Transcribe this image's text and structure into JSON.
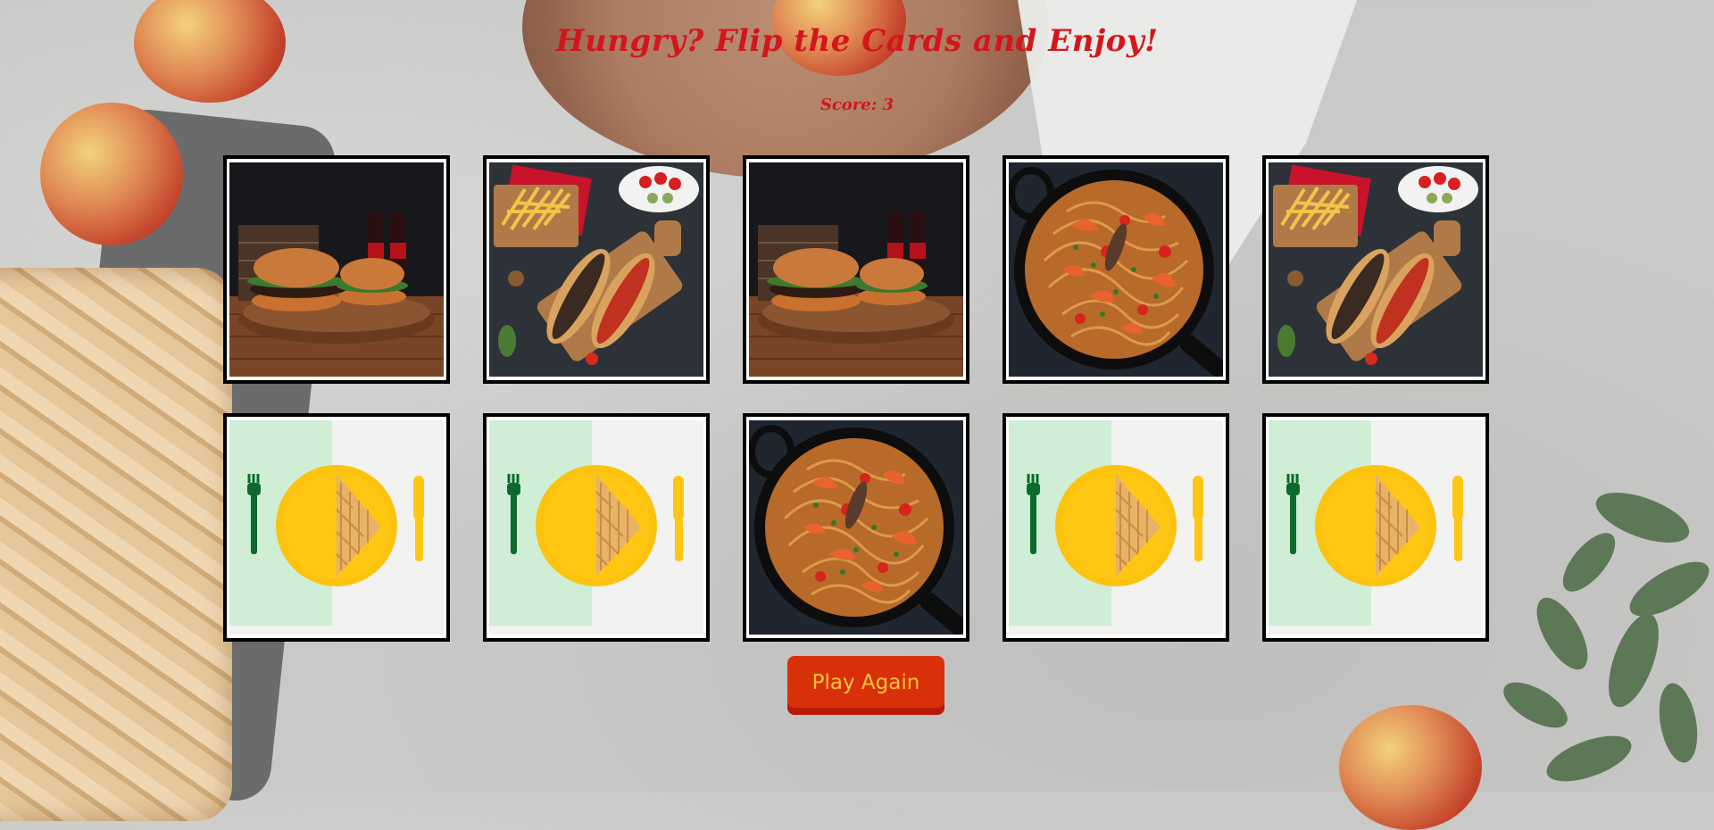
{
  "game": {
    "title": "Hungry? Flip the Cards and Enjoy!",
    "score_text": "Score: 3",
    "play_again_label": "Play Again"
  },
  "cards": [
    {
      "face": "burger-image",
      "state": "flipped"
    },
    {
      "face": "hotdog-fries-image",
      "state": "flipped"
    },
    {
      "face": "burger-image",
      "state": "flipped"
    },
    {
      "face": "shrimp-pasta-image",
      "state": "flipped"
    },
    {
      "face": "hotdog-fries-image",
      "state": "flipped"
    },
    {
      "face": "card-back-waffle-plate",
      "state": "face-down"
    },
    {
      "face": "card-back-waffle-plate",
      "state": "face-down"
    },
    {
      "face": "shrimp-pasta-image",
      "state": "flipped"
    },
    {
      "face": "card-back-waffle-plate",
      "state": "face-down"
    },
    {
      "face": "card-back-waffle-plate",
      "state": "face-down"
    }
  ],
  "colors": {
    "title": "#d4161b",
    "button_bg": "#d9300c",
    "button_text": "#f6c63a",
    "card_border": "#000000"
  }
}
